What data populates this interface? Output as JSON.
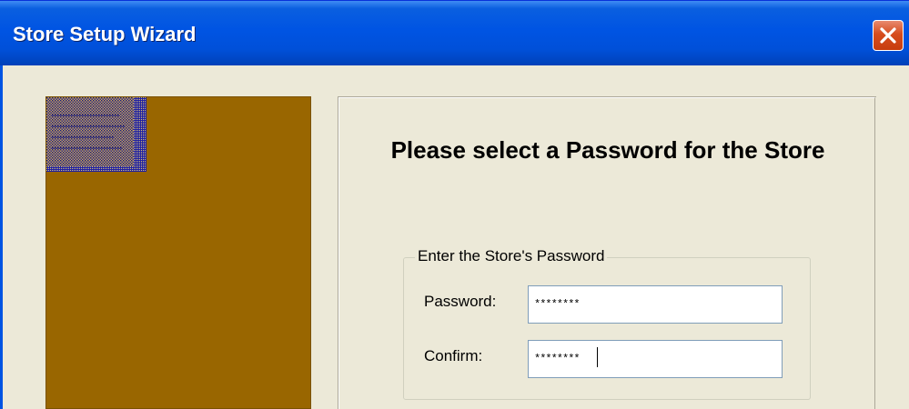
{
  "window": {
    "title": "Store Setup Wizard",
    "close_icon": "close-icon"
  },
  "heading": "Please select a Password for the Store",
  "group": {
    "legend": "Enter the Store's Password",
    "password_label": "Password:",
    "password_value": "********",
    "confirm_label": "Confirm:",
    "confirm_value": "********"
  },
  "colors": {
    "titlebar": "#0054e3",
    "side_panel": "#996600",
    "dialog_bg": "#ece9d8",
    "close_button": "#d64d1e"
  }
}
